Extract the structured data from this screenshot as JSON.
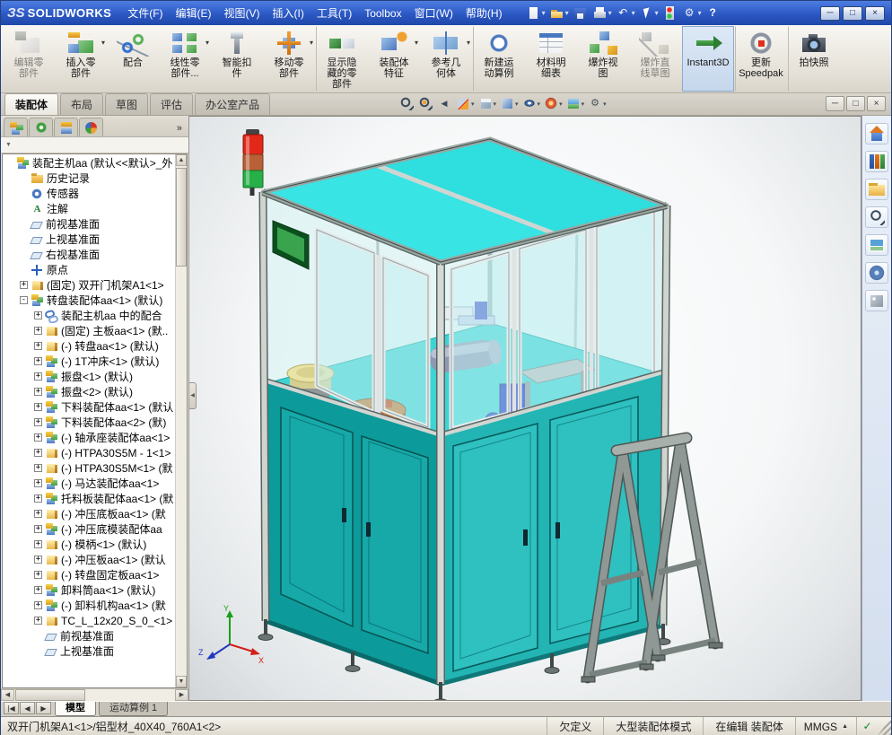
{
  "titlebar": {
    "logo_prefix": "ЗS",
    "logo_text": "SOLIDWORKS",
    "menus": [
      "文件(F)",
      "编辑(E)",
      "视图(V)",
      "插入(I)",
      "工具(T)",
      "Toolbox",
      "窗口(W)",
      "帮助(H)"
    ],
    "quick_icons": [
      {
        "icon": "new-document",
        "dd": true
      },
      {
        "icon": "open-folder",
        "dd": true
      },
      {
        "icon": "save",
        "dd": false
      },
      {
        "icon": "print",
        "dd": true
      },
      {
        "icon": "undo",
        "dd": true
      },
      {
        "icon": "select-arrow",
        "dd": true
      },
      {
        "icon": "rebuild",
        "dd": false
      },
      {
        "icon": "options",
        "dd": true
      },
      {
        "icon": "help",
        "dd": false
      }
    ],
    "window_buttons": [
      {
        "icon": "minimize",
        "glyph": "─"
      },
      {
        "icon": "restore",
        "glyph": "□"
      },
      {
        "icon": "close",
        "glyph": "×"
      }
    ]
  },
  "toolbar": {
    "buttons": [
      {
        "icon": "edit-component",
        "label": "编辑零\n部件",
        "disabled": true
      },
      {
        "icon": "insert-components",
        "label": "插入零\n部件",
        "dd": true
      },
      {
        "icon": "mate",
        "label": "配合"
      },
      {
        "icon": "linear-component-pattern",
        "label": "线性零\n部件...",
        "dd": true
      },
      {
        "icon": "smart-fasteners",
        "label": "智能扣\n件"
      },
      {
        "icon": "move-component",
        "label": "移动零\n部件",
        "dd": true
      },
      {
        "icon": "show-hidden-components",
        "label": "显示隐\n藏的零\n部件",
        "sep": true
      },
      {
        "icon": "assembly-features",
        "label": "装配体\n特征",
        "dd": true
      },
      {
        "icon": "reference-geometry",
        "label": "参考几\n何体",
        "dd": true
      },
      {
        "icon": "new-motion-study",
        "label": "新建运\n动算例",
        "sep": true
      },
      {
        "icon": "bill-of-materials",
        "label": "材料明\n细表"
      },
      {
        "icon": "exploded-view",
        "label": "爆炸视\n图"
      },
      {
        "icon": "explode-line-sketch",
        "label": "爆炸直\n线草图",
        "disabled": true
      },
      {
        "icon": "instant3d",
        "label": "Instant3D",
        "pressed": true,
        "sep": true
      },
      {
        "icon": "update-speedpak",
        "label": "更新\nSpeedpak",
        "sep": true
      },
      {
        "icon": "take-snapshot",
        "label": "拍快照",
        "sep": true
      }
    ]
  },
  "command_tabs": [
    {
      "label": "装配体",
      "active": true
    },
    {
      "label": "布局"
    },
    {
      "label": "草图"
    },
    {
      "label": "评估"
    },
    {
      "label": "办公室产品"
    }
  ],
  "hud_buttons": [
    {
      "icon": "zoom-fit"
    },
    {
      "icon": "zoom-area"
    },
    {
      "icon": "previous-view"
    },
    {
      "icon": "section-view",
      "dd": true
    },
    {
      "icon": "view-orientation",
      "dd": true
    },
    {
      "icon": "display-style",
      "dd": true
    },
    {
      "icon": "hide-show-items",
      "dd": true
    },
    {
      "icon": "edit-appearance",
      "dd": true
    },
    {
      "icon": "apply-scene",
      "dd": true
    },
    {
      "icon": "view-settings",
      "dd": true
    }
  ],
  "doc_buttons": [
    {
      "icon": "document-minimize",
      "glyph": "─"
    },
    {
      "icon": "document-restore",
      "glyph": "□"
    },
    {
      "icon": "document-close",
      "glyph": "×"
    }
  ],
  "feature_panel": {
    "tab_icons": [
      "featuremanager-tree",
      "propertymanager",
      "configurationmanager",
      "appearance-manager"
    ],
    "overflow": "»",
    "tree": {
      "items": [
        {
          "level": 0,
          "exp": "none",
          "icon": "assembly",
          "label": "装配主机aa  (默认<<默认>_外"
        },
        {
          "level": 1,
          "exp": "none",
          "icon": "history",
          "label": "历史记录"
        },
        {
          "level": 1,
          "exp": "none",
          "icon": "sensor",
          "label": "传感器"
        },
        {
          "level": 1,
          "exp": "none",
          "icon": "annotation",
          "label": "注解"
        },
        {
          "level": 1,
          "exp": "none",
          "icon": "plane",
          "label": "前视基准面"
        },
        {
          "level": 1,
          "exp": "none",
          "icon": "plane",
          "label": "上视基准面"
        },
        {
          "level": 1,
          "exp": "none",
          "icon": "plane",
          "label": "右视基准面"
        },
        {
          "level": 1,
          "exp": "none",
          "icon": "origin",
          "label": "原点"
        },
        {
          "level": 1,
          "exp": "plus",
          "icon": "part",
          "label": "(固定) 双开门机架A1<1>"
        },
        {
          "level": 1,
          "exp": "minus",
          "icon": "assembly",
          "label": "转盘装配体aa<1> (默认)"
        },
        {
          "level": 2,
          "exp": "plus",
          "icon": "mates",
          "label": "装配主机aa 中的配合"
        },
        {
          "level": 2,
          "exp": "plus",
          "icon": "part",
          "label": "(固定) 主板aa<1> (默.."
        },
        {
          "level": 2,
          "exp": "plus",
          "icon": "part",
          "label": "(-) 转盘aa<1> (默认)"
        },
        {
          "level": 2,
          "exp": "plus",
          "icon": "assembly",
          "label": "(-) 1T冲床<1> (默认)"
        },
        {
          "level": 2,
          "exp": "plus",
          "icon": "assembly",
          "label": "振盘<1> (默认)"
        },
        {
          "level": 2,
          "exp": "plus",
          "icon": "assembly",
          "label": "振盘<2> (默认)"
        },
        {
          "level": 2,
          "exp": "plus",
          "icon": "assembly",
          "label": "下料装配体aa<1> (默认"
        },
        {
          "level": 2,
          "exp": "plus",
          "icon": "assembly",
          "label": "下料装配体aa<2> (默)"
        },
        {
          "level": 2,
          "exp": "plus",
          "icon": "assembly",
          "label": "(-) 轴承座装配体aa<1>"
        },
        {
          "level": 2,
          "exp": "plus",
          "icon": "part",
          "label": "(-) HTPA30S5M - 1<1>"
        },
        {
          "level": 2,
          "exp": "plus",
          "icon": "part",
          "label": "(-) HTPA30S5M<1> (默"
        },
        {
          "level": 2,
          "exp": "plus",
          "icon": "assembly",
          "label": "(-) 马达装配体aa<1>"
        },
        {
          "level": 2,
          "exp": "plus",
          "icon": "assembly",
          "label": "托料板装配体aa<1> (默"
        },
        {
          "level": 2,
          "exp": "plus",
          "icon": "part",
          "label": "(-) 冲压底板aa<1> (默"
        },
        {
          "level": 2,
          "exp": "plus",
          "icon": "assembly",
          "label": "(-) 冲压底模装配体aa"
        },
        {
          "level": 2,
          "exp": "plus",
          "icon": "part",
          "label": "(-) 模柄<1> (默认)"
        },
        {
          "level": 2,
          "exp": "plus",
          "icon": "part",
          "label": "(-) 冲压板aa<1> (默认"
        },
        {
          "level": 2,
          "exp": "plus",
          "icon": "part",
          "label": "(-) 转盘固定板aa<1>"
        },
        {
          "level": 2,
          "exp": "plus",
          "icon": "assembly",
          "label": "卸料筒aa<1> (默认)"
        },
        {
          "level": 2,
          "exp": "plus",
          "icon": "assembly",
          "label": "(-) 卸料机构aa<1> (默"
        },
        {
          "level": 2,
          "exp": "plus",
          "icon": "part",
          "label": "TC_L_12x20_S_0_<1>"
        },
        {
          "level": 2,
          "exp": "none",
          "icon": "plane",
          "label": "前视基准面"
        },
        {
          "level": 2,
          "exp": "none",
          "icon": "plane",
          "label": "上视基准面"
        }
      ]
    }
  },
  "taskpane": {
    "icons": [
      "resources-home",
      "design-library",
      "file-explorer",
      "search",
      "view-palette",
      "appearances",
      "custom-properties"
    ]
  },
  "bottom": {
    "nav": [
      "|◀",
      "◀",
      "▶"
    ],
    "tabs": [
      {
        "label": "模型",
        "active": true
      },
      {
        "label": "运动算例 1"
      }
    ]
  },
  "status": {
    "left": "双开门机架A1<1>/铝型材_40X40_760A1<2>",
    "chips": [
      "欠定义",
      "大型装配体模式",
      "在编辑 装配体"
    ],
    "units": "MMGS",
    "check_glyph": "✓"
  },
  "viewport": {
    "colors": {
      "roof_cyan": "#34e4e4",
      "cabinet_teal_left": "#0d9a9a",
      "cabinet_teal_right": "#23b4b4",
      "glass": "#bfeef0",
      "aluminum_frame": "#cfd4cf",
      "stand_gray": "#8f9894",
      "tower_red": "#e22818",
      "tower_green": "#28b048",
      "axis_x_red": "#d02018",
      "axis_y_green": "#18a018",
      "axis_z_blue": "#2038c0"
    }
  }
}
